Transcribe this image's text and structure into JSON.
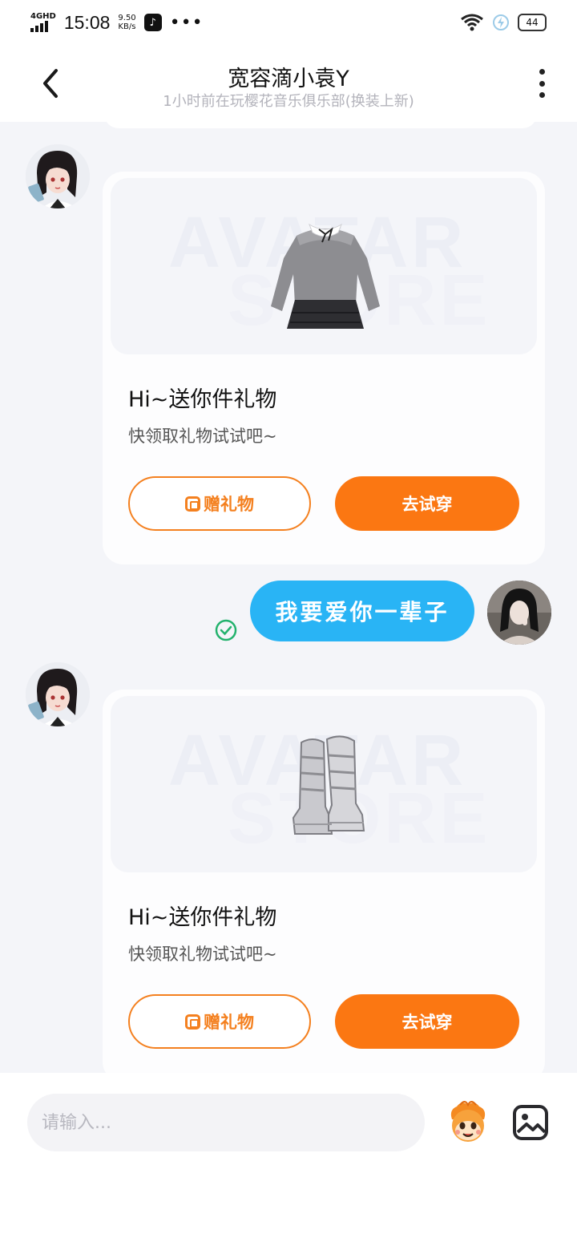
{
  "status_bar": {
    "network": "4GHD",
    "time": "15:08",
    "speed_value": "9.50",
    "speed_unit": "KB/s",
    "more": "•••",
    "battery": "44"
  },
  "header": {
    "title": "宽容滴小袁Y",
    "subtitle": "1小时前在玩樱花音乐俱乐部(换装上新)"
  },
  "messages": [
    {
      "type": "gift",
      "title": "Hi~送你件礼物",
      "desc": "快领取礼物试试吧~",
      "gift_button": "赠礼物",
      "try_button": "去试穿",
      "watermark_top": "AVATAR",
      "watermark_bottom": "STORE"
    },
    {
      "type": "text",
      "text": "我要爱你一辈子"
    },
    {
      "type": "gift",
      "title": "Hi~送你件礼物",
      "desc": "快领取礼物试试吧~",
      "gift_button": "赠礼物",
      "try_button": "去试穿",
      "watermark_top": "AVATAR",
      "watermark_bottom": "STORE"
    }
  ],
  "input": {
    "placeholder": "请输入..."
  },
  "colors": {
    "accent_orange": "#fb7712",
    "bubble_blue": "#29b4f5",
    "sent_green": "#23b26d"
  }
}
